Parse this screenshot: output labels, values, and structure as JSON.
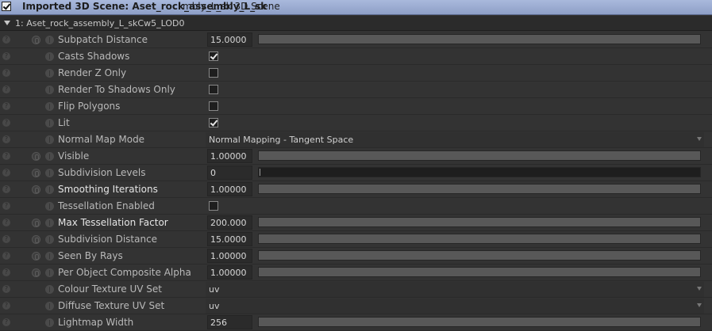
{
  "window": {
    "title": "Imported 3D Scene: Aset_rock_assembly_L_sk",
    "title_overlap": "mbly_L_sk 3D Scene"
  },
  "group": {
    "label": "1: Aset_rock_assembly_L_skCw5_LOD0",
    "expanded": true
  },
  "rows": [
    {
      "label": "Subpatch Distance",
      "kind": "slider",
      "value": "15.0000",
      "fill": 1.0,
      "bright": false
    },
    {
      "label": "Casts Shadows",
      "kind": "checkbox",
      "checked": true,
      "bright": false
    },
    {
      "label": "Render Z Only",
      "kind": "checkbox",
      "checked": false,
      "bright": false
    },
    {
      "label": "Render To Shadows Only",
      "kind": "checkbox",
      "checked": false,
      "bright": false
    },
    {
      "label": "Flip Polygons",
      "kind": "checkbox",
      "checked": false,
      "bright": false
    },
    {
      "label": "Lit",
      "kind": "checkbox",
      "checked": true,
      "bright": false
    },
    {
      "label": "Normal Map Mode",
      "kind": "dropdown",
      "value": "Normal Mapping - Tangent Space",
      "bright": false
    },
    {
      "label": "Visible",
      "kind": "slider",
      "value": "1.00000",
      "fill": 1.0,
      "bright": false
    },
    {
      "label": "Subdivision Levels",
      "kind": "slider",
      "value": "0",
      "fill": 0.0,
      "bright": false
    },
    {
      "label": "Smoothing Iterations",
      "kind": "slider",
      "value": "1.00000",
      "fill": 1.0,
      "bright": true
    },
    {
      "label": "Tessellation Enabled",
      "kind": "checkbox",
      "checked": false,
      "bright": false
    },
    {
      "label": "Max Tessellation Factor",
      "kind": "slider",
      "value": "200.000",
      "fill": 1.0,
      "bright": true
    },
    {
      "label": "Subdivision Distance",
      "kind": "slider",
      "value": "15.0000",
      "fill": 1.0,
      "bright": false
    },
    {
      "label": "Seen By Rays",
      "kind": "slider",
      "value": "1.00000",
      "fill": 1.0,
      "bright": false
    },
    {
      "label": "Per Object Composite Alpha",
      "kind": "slider",
      "value": "1.00000",
      "fill": 1.0,
      "bright": false
    },
    {
      "label": "Colour Texture UV Set",
      "kind": "dropdown",
      "value": "uv",
      "bright": false
    },
    {
      "label": "Diffuse Texture UV Set",
      "kind": "dropdown",
      "value": "uv",
      "bright": false
    },
    {
      "label": "Lightmap Width",
      "kind": "slider",
      "value": "256",
      "fill": 1.0,
      "bright": false
    }
  ],
  "linkable_rows": [
    0,
    7,
    8,
    9,
    11,
    12,
    13,
    14
  ]
}
